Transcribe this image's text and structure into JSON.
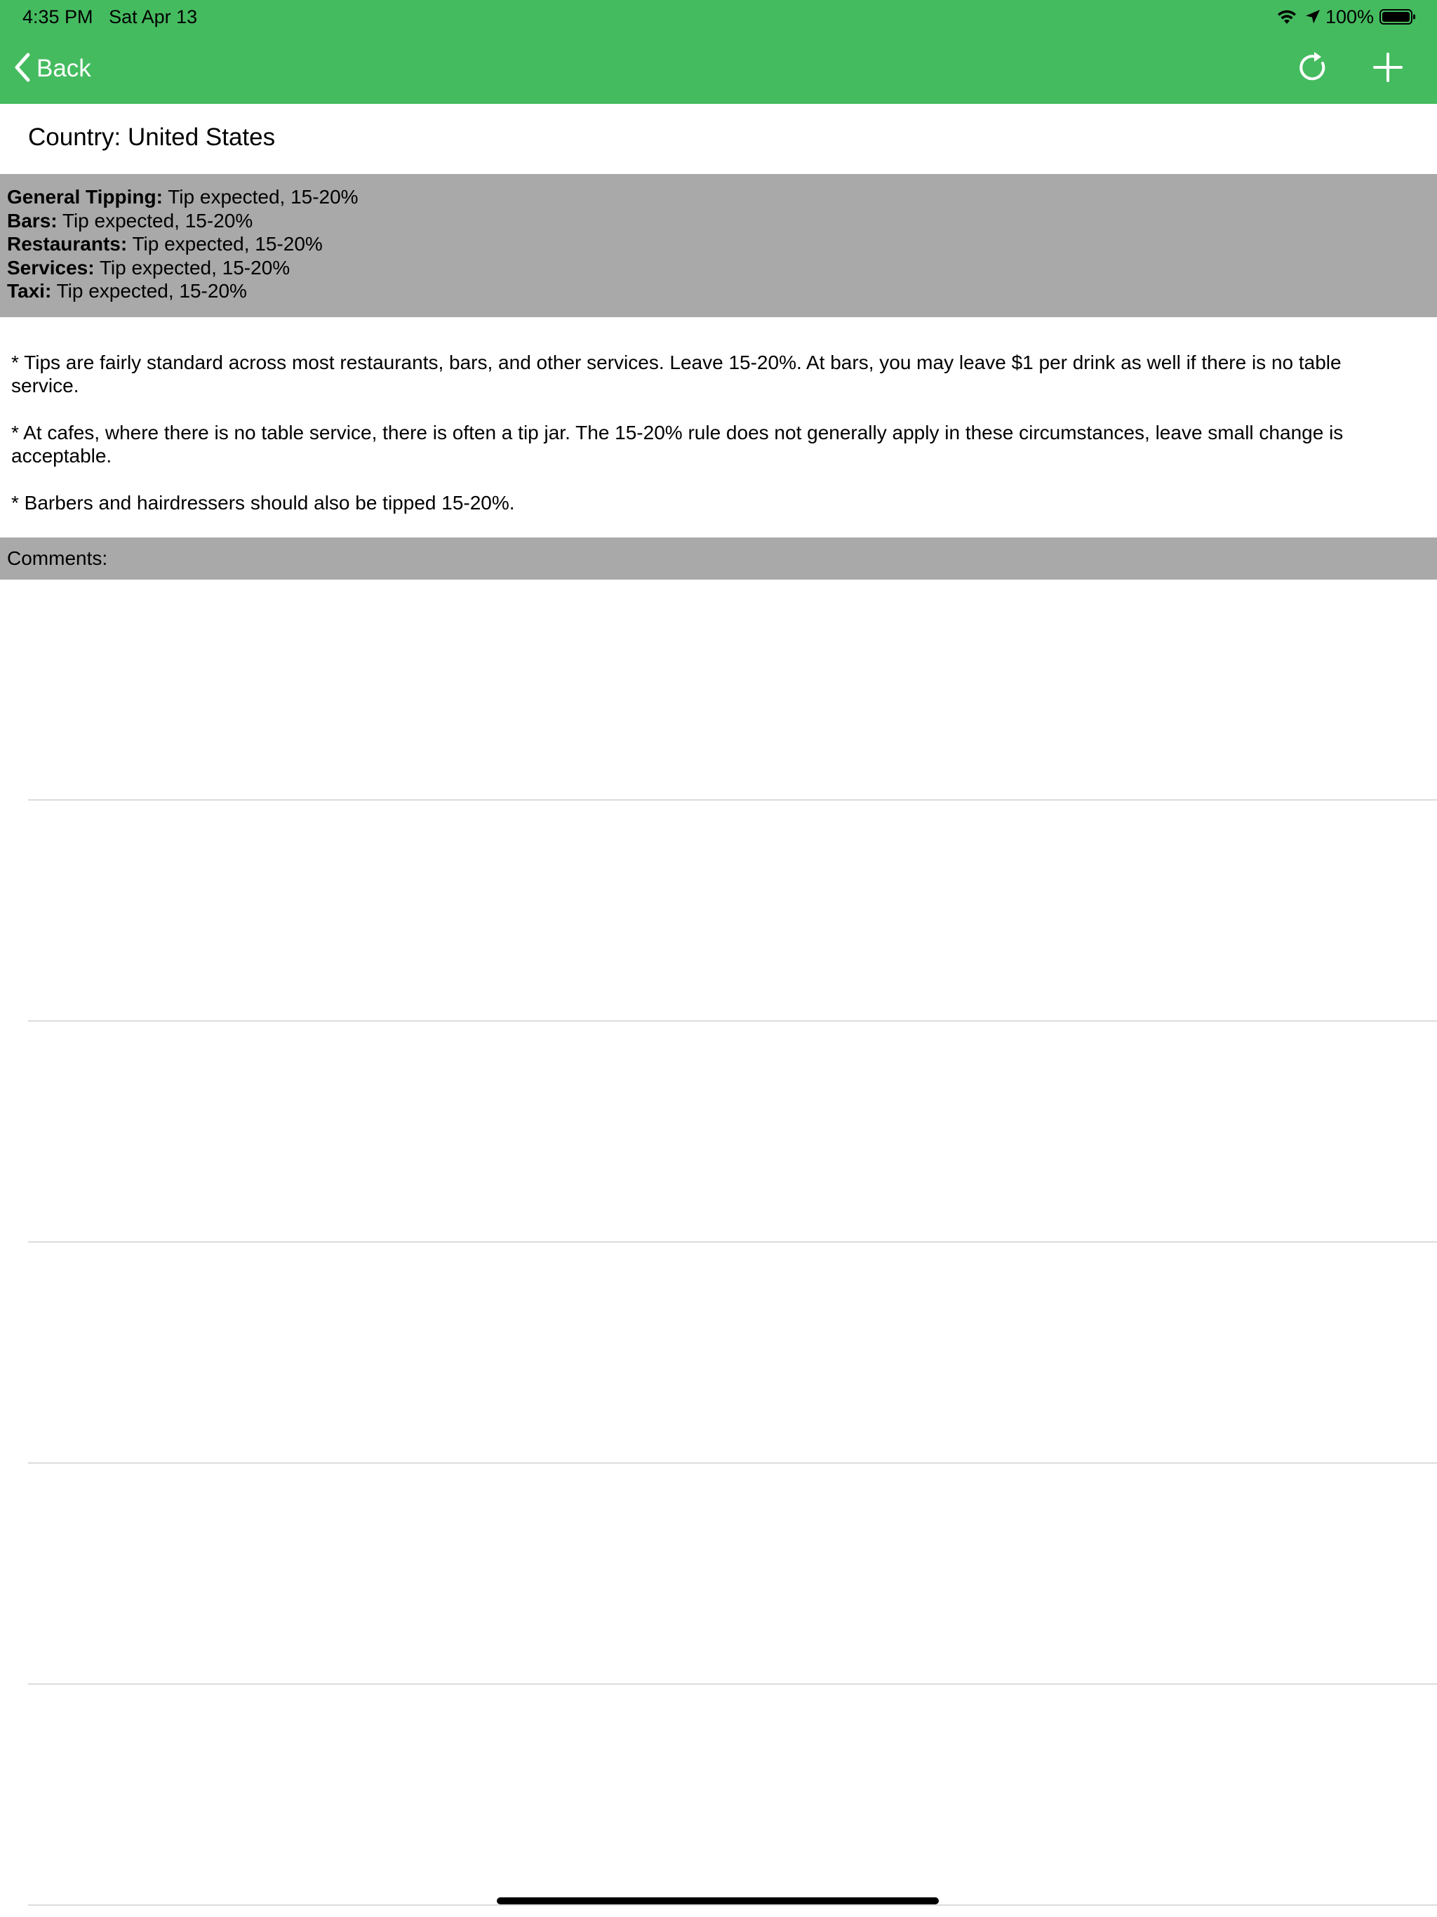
{
  "status_bar": {
    "time": "4:35 PM",
    "date": "Sat Apr 13",
    "battery_percent": "100%",
    "battery_level": 1.0,
    "icons": [
      "wifi-icon",
      "location-arrow-icon",
      "battery-icon"
    ]
  },
  "nav": {
    "back_label": "Back",
    "icons": [
      "chevron-left-icon",
      "refresh-icon",
      "plus-icon"
    ]
  },
  "country": {
    "title": "Country: United States"
  },
  "summary": [
    {
      "label": "General Tipping:",
      "value": "Tip expected, 15-20%"
    },
    {
      "label": "Bars:",
      "value": "Tip expected, 15-20%"
    },
    {
      "label": "Restaurants:",
      "value": "Tip expected, 15-20%"
    },
    {
      "label": "Services:",
      "value": "Tip expected, 15-20%"
    },
    {
      "label": "Taxi:",
      "value": "Tip expected, 15-20%"
    }
  ],
  "notes": [
    "* Tips are fairly standard across most restaurants, bars, and other services. Leave 15-20%. At bars, you may leave $1 per drink as well if there is no table service.",
    "* At cafes, where there is no table service, there is often a tip jar. The 15-20% rule does not generally apply in these circumstances, leave small change is acceptable.",
    "* Barbers and hairdressers should also be tipped 15-20%."
  ],
  "comments": {
    "header": "Comments:",
    "rows": [
      "",
      "",
      "",
      "",
      "",
      ""
    ]
  },
  "colors": {
    "nav_green": "#45bb5f",
    "panel_gray": "#a9a9a9",
    "separator": "#dcdcdc"
  }
}
